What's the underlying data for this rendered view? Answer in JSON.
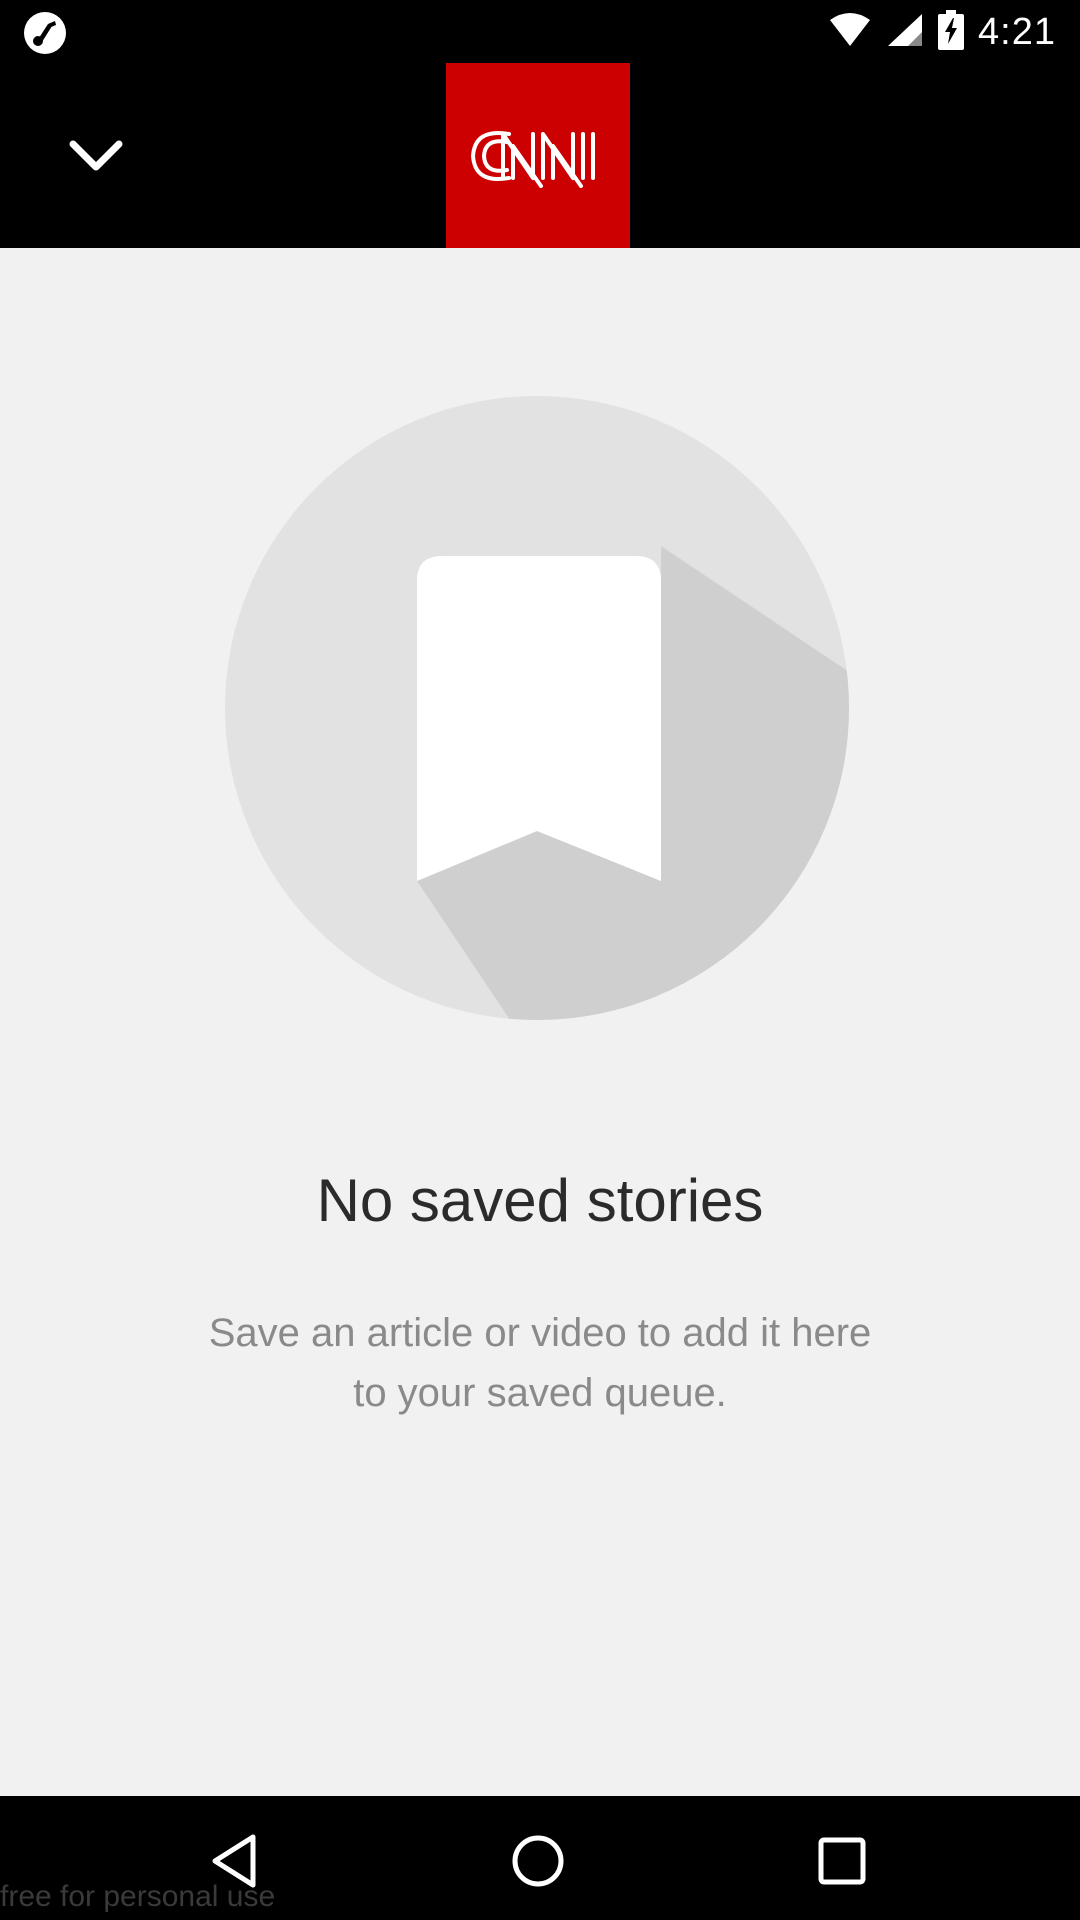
{
  "status_bar": {
    "time": "4:21",
    "left_icon": "music-note-circle-icon",
    "icons": [
      "wifi-icon",
      "cell-signal-icon",
      "battery-charging-icon"
    ]
  },
  "app_bar": {
    "back_icon": "chevron-down-icon",
    "logo_text": "CNN",
    "logo_color": "#cc0000"
  },
  "empty_state": {
    "icon": "bookmark-icon",
    "title": "No saved stories",
    "description": "Save an article or video to add it here to your saved queue."
  },
  "nav_bar": {
    "icons": [
      "back-triangle-icon",
      "home-circle-icon",
      "recents-square-icon"
    ]
  },
  "watermark": "free for personal use"
}
